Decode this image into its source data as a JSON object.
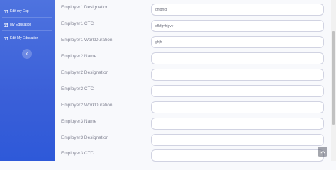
{
  "sidebar": {
    "items": [
      {
        "label": "Edit my Exp",
        "icon": "table-icon"
      },
      {
        "label": "My Education",
        "icon": "table-icon"
      },
      {
        "label": "Edit My Education",
        "icon": "table-icon"
      }
    ],
    "toggle_icon": "‹"
  },
  "form": {
    "fields": [
      {
        "label": "Employer1 Designation",
        "value": "ghjghjg"
      },
      {
        "label": "Employer1 CTC",
        "value": "dfhfgvhjgvv"
      },
      {
        "label": "Employer1 WorkDuration",
        "value": "ghjh"
      },
      {
        "label": "Employer2 Name",
        "value": ""
      },
      {
        "label": "Employer2 Designation",
        "value": ""
      },
      {
        "label": "Employer2 CTC",
        "value": ""
      },
      {
        "label": "Employer2 WorkDuration",
        "value": ""
      },
      {
        "label": "Employer3 Name",
        "value": ""
      },
      {
        "label": "Employer3 Designation",
        "value": ""
      },
      {
        "label": "Employer3 CTC",
        "value": ""
      }
    ]
  },
  "colors": {
    "sidebar_accent": "#4e73df",
    "label_text": "#858796",
    "input_border": "#d1d3e2"
  }
}
